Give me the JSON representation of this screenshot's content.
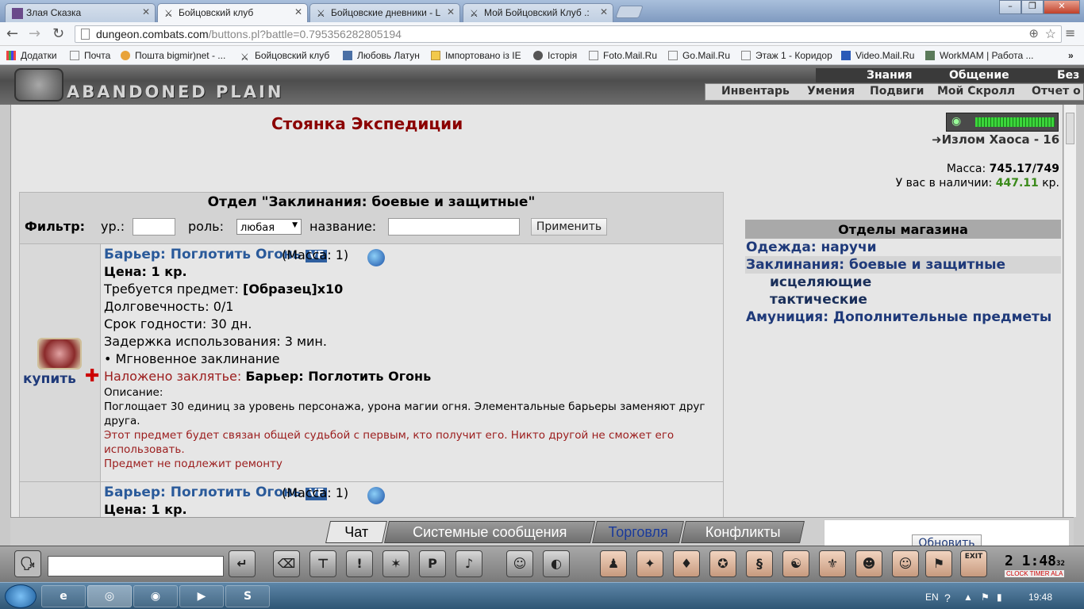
{
  "browser": {
    "tabs": [
      {
        "label": "Злая Сказка",
        "active": false
      },
      {
        "label": "Бойцовский клуб",
        "active": true
      },
      {
        "label": "Бойцовские дневники - L",
        "active": false
      },
      {
        "label": "Мой Бойцовский Клуб .:",
        "active": false
      }
    ],
    "url_host": "dungeon.combats.com",
    "url_path": "/buttons.pl?battle=0.795356282805194",
    "bookmarks": [
      "Додатки",
      "Почта",
      "Пошта bigmir)net - ...",
      "Бойцовский клуб",
      "Любовь Латун",
      "Імпортовано із IE",
      "Історія",
      "Foto.Mail.Ru",
      "Go.Mail.Ru",
      "Этаж 1 - Коридор",
      "Video.Mail.Ru",
      "WorkMAM | Работа ..."
    ]
  },
  "game": {
    "logo_text": "ABANDONED PLAIN",
    "top_nav": [
      "Знания",
      "Общение",
      "Без"
    ],
    "sub_nav": [
      "Инвентарь",
      "Умения",
      "Подвиги",
      "Мой Скролл",
      "Отчет о"
    ]
  },
  "shop": {
    "title": "Стоянка Экспедиции",
    "chaos_label": "Излом Хаоса - 16",
    "mass_label": "Масса:",
    "mass_value": "745.17/749",
    "money_label": "У вас в наличии:",
    "money_value": "447.11",
    "money_unit": "кр.",
    "department": "Отдел \"Заклинания: боевые и защитные\"",
    "filter": {
      "label": "Фильтр:",
      "level_label": "ур.:",
      "level_value": "",
      "role_label": "роль:",
      "role_value": "любая",
      "name_label": "название:",
      "name_value": "",
      "apply": "Применить"
    },
    "items": [
      {
        "name": "Барьер: Поглотить Огонь",
        "badge": "VF",
        "mass": "(Масса: 1)",
        "buy": "купить",
        "price": "Цена: 1 кр.",
        "requires_label": "Требуется предмет:",
        "requires_value": "[Образец]x10",
        "durability": "Долговечность: 0/1",
        "expiry": "Срок годности: 30 дн.",
        "delay": "Задержка использования: 3 мин.",
        "instant": "• Мгновенное заклинание",
        "spell_label": "Наложено заклятье:",
        "spell_value": "Барьер: Поглотить Огонь",
        "desc_label": "Описание:",
        "desc": "Поглощает 30 единиц за уровень персонажа, урона магии огня. Элементальные барьеры заменяют друг друга.",
        "bound": "Этот предмет будет связан общей судьбой с первым, кто получит его. Никто другой не сможет его использовать.",
        "norepair": "Предмет не подлежит ремонту"
      },
      {
        "name": "Барьер: Поглотить Огонь",
        "badge": "VF",
        "mass": "(Масса: 1)",
        "price": "Цена: 1 кр."
      }
    ],
    "departments_title": "Отделы магазина",
    "departments": [
      {
        "label": "Одежда: наручи",
        "indent": false,
        "selected": false
      },
      {
        "label": "Заклинания: боевые и защитные",
        "indent": false,
        "selected": true
      },
      {
        "label": "исцеляющие",
        "indent": true,
        "selected": false
      },
      {
        "label": "тактические",
        "indent": true,
        "selected": false
      },
      {
        "label": "Амуниция: Дополнительные предметы",
        "indent": false,
        "selected": false
      }
    ]
  },
  "chat": {
    "tabs": [
      "Чат",
      "Системные сообщения",
      "Торговля",
      "Конфликты"
    ],
    "refresh": "Обновить"
  },
  "bottom": {
    "clock": "2 1:48",
    "clock_sec": "32",
    "clock_labels": "CLOCK TIMER ALA",
    "exit": "EXIT"
  },
  "taskbar": {
    "lang": "EN",
    "time": "19:48"
  },
  "colors": {
    "title_red": "#8b0000",
    "link_blue": "#1f3a7a",
    "money_green": "#3a8a1a",
    "item_name_blue": "#2a5a9a"
  }
}
